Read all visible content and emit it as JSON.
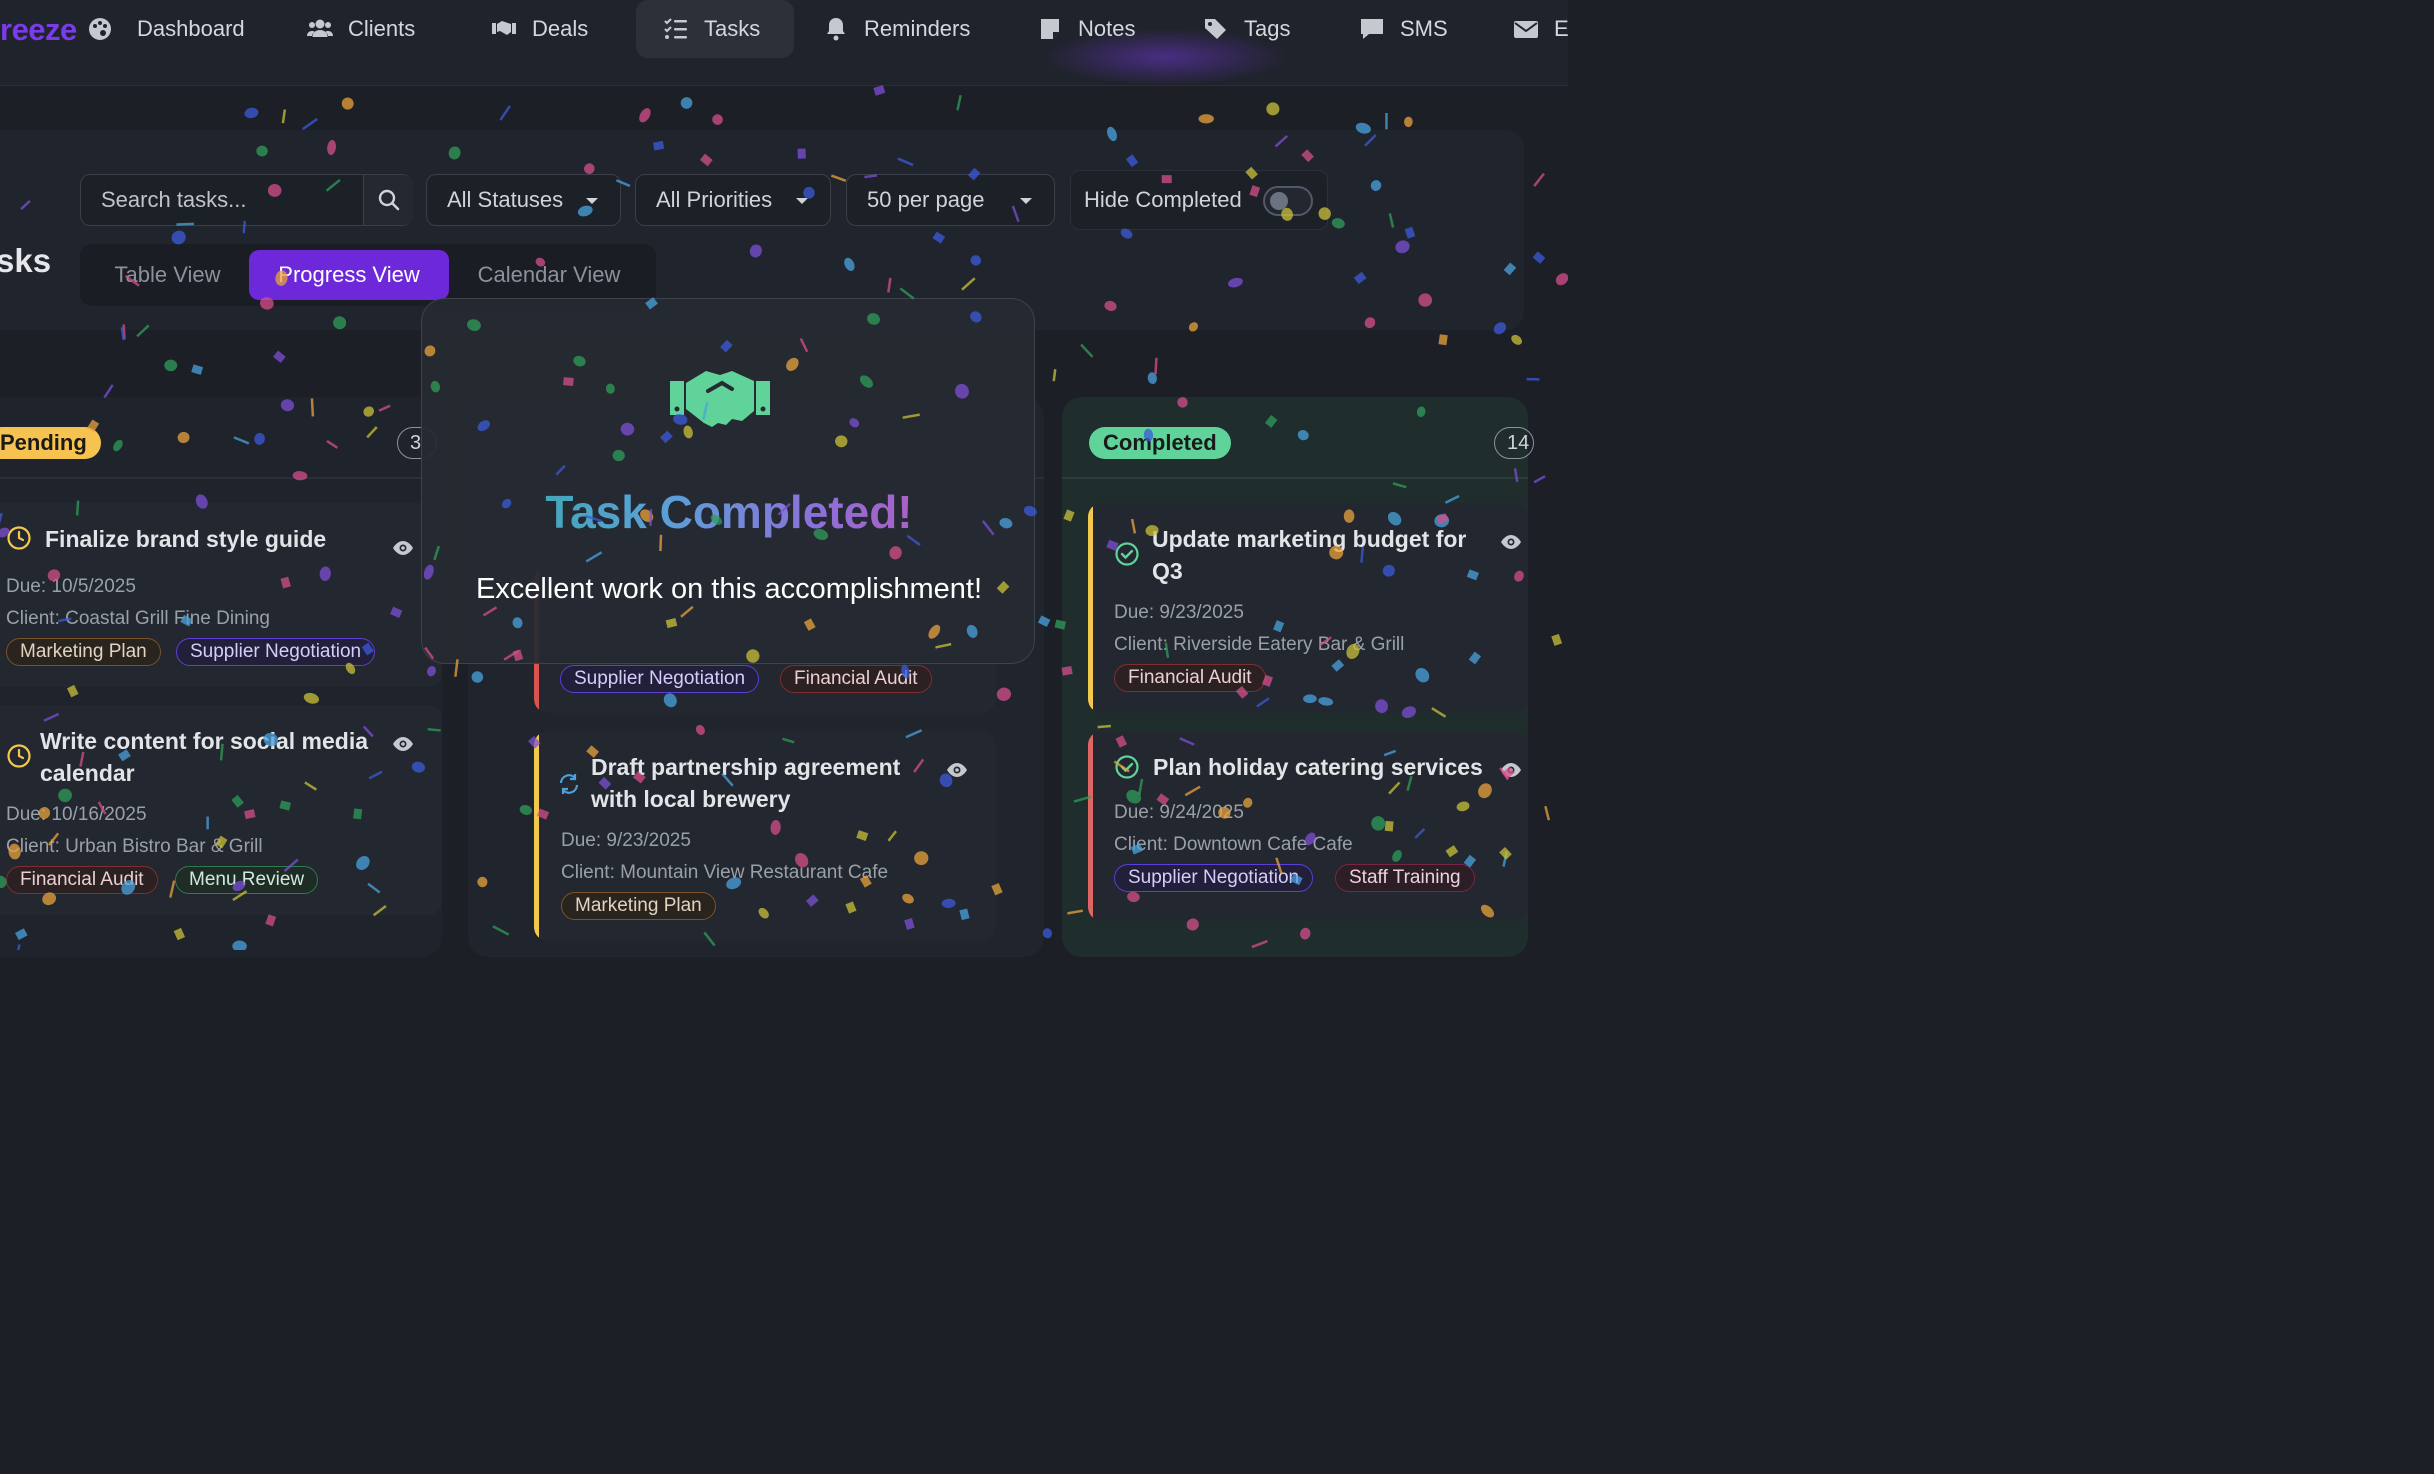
{
  "brand": {
    "name": "reeze"
  },
  "nav": {
    "items": [
      {
        "label": "Dashboard",
        "icon": "palette-icon"
      },
      {
        "label": "Clients",
        "icon": "users-icon"
      },
      {
        "label": "Deals",
        "icon": "handshake-icon"
      },
      {
        "label": "Tasks",
        "icon": "list-check-icon",
        "active": true
      },
      {
        "label": "Reminders",
        "icon": "bell-icon"
      },
      {
        "label": "Notes",
        "icon": "note-icon"
      },
      {
        "label": "Tags",
        "icon": "tags-icon"
      },
      {
        "label": "SMS",
        "icon": "comment-icon"
      },
      {
        "label": "E",
        "icon": "envelope-icon"
      }
    ]
  },
  "toolbar": {
    "search_placeholder": "Search tasks...",
    "status_filter": "All Statuses",
    "priority_filter": "All Priorities",
    "per_page": "50 per page",
    "hide_completed_label": "Hide Completed",
    "hide_completed_on": false
  },
  "page_title": "sks",
  "views": {
    "table": "Table View",
    "progress": "Progress View",
    "calendar": "Calendar View",
    "active": "progress"
  },
  "columns": {
    "pending": {
      "label": "Pending",
      "count": "3",
      "color": "#f6c350",
      "cards": [
        {
          "title": "Finalize brand style guide",
          "due": "Due: 10/5/2025",
          "client": "Client: Coastal Grill Fine Dining",
          "tags": [
            "Marketing Plan",
            "Supplier Negotiation"
          ]
        },
        {
          "title_line1": "Write content for social media",
          "title_line2": "calendar",
          "due": "Due: 10/16/2025",
          "client": "Client: Urban Bistro Bar & Grill",
          "tags": [
            "Financial Audit",
            "Menu Review"
          ]
        }
      ]
    },
    "in_progress": {
      "cards": [
        {
          "tags": [
            "Supplier Negotiation",
            "Financial Audit"
          ],
          "accent": "#d9534f"
        },
        {
          "title_line1": "Draft partnership agreement",
          "title_line2": "with local brewery",
          "due": "Due: 9/23/2025",
          "client": "Client: Mountain View Restaurant Cafe",
          "tags": [
            "Marketing Plan"
          ],
          "accent": "#f2c94c"
        }
      ]
    },
    "completed": {
      "label": "Completed",
      "count": "14",
      "color": "#5fd39a",
      "cards": [
        {
          "title_line1": "Update marketing budget for",
          "title_line2": "Q3",
          "due": "Due: 9/23/2025",
          "client": "Client: Riverside Eatery Bar & Grill",
          "tags": [
            "Financial Audit"
          ],
          "accent": "#f2c94c"
        },
        {
          "title": "Plan holiday catering services",
          "due": "Due: 9/24/2025",
          "client": "Client: Downtown Cafe Cafe",
          "tags": [
            "Supplier Negotiation",
            "Staff Training"
          ],
          "accent": "#e06666"
        }
      ]
    }
  },
  "modal": {
    "icon": "handshake-icon",
    "title": "Task Completed!",
    "subtitle": "Excellent work on this accomplishment!",
    "icon_color": "#5fd39a"
  }
}
